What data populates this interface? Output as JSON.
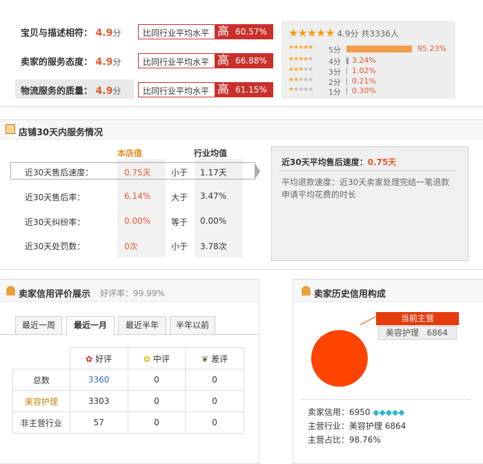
{
  "ratings": [
    {
      "label": "宝贝与描述相符：",
      "score": "4.9",
      "unit": "分",
      "compare": "比同行业平均水平",
      "level": "高",
      "pct": "60.57%"
    },
    {
      "label": "卖家的服务态度：",
      "score": "4.9",
      "unit": "分",
      "compare": "比同行业平均水平",
      "level": "高",
      "pct": "66.88%"
    },
    {
      "label": "物流服务的质量：",
      "score": "4.9",
      "unit": "分",
      "compare": "比同行业平均水平",
      "level": "高",
      "pct": "61.15%"
    }
  ],
  "summary": {
    "score": "4.9分",
    "total": "共3336人"
  },
  "distribution": [
    {
      "label": "5分",
      "pct": "95.23%",
      "stars": 5,
      "fraction": 0.9523
    },
    {
      "label": "4分",
      "pct": "3.24%",
      "stars": 4,
      "fraction": 0.0324
    },
    {
      "label": "3分",
      "pct": "1.02%",
      "stars": 3,
      "fraction": 0.0102
    },
    {
      "label": "2分",
      "pct": "0.21%",
      "stars": 2,
      "fraction": 0.0021
    },
    {
      "label": "1分",
      "pct": "0.30%",
      "stars": 1,
      "fraction": 0.003
    }
  ],
  "service": {
    "title": "店铺30天内服务情况",
    "col_store": "本店值",
    "col_avg": "行业均值",
    "rows": [
      {
        "label": "近30天售后速度：",
        "value": "0.75天",
        "cmp": "小于",
        "avg": "1.17天"
      },
      {
        "label": "近30天售后率：",
        "value": "6.14%",
        "cmp": "大于",
        "avg": "3.47%"
      },
      {
        "label": "近30天纠纷率：",
        "value": "0.00%",
        "cmp": "等于",
        "avg": "0.00%"
      },
      {
        "label": "近30天处罚数：",
        "value": "0次",
        "cmp": "小于",
        "avg": "3.78次"
      }
    ],
    "detail_title": "近30天平均售后速度：",
    "detail_value": "0.75天",
    "detail_desc": "平均退款速度：近30天卖家处理完结一笔退款申请平均花费的时长"
  },
  "credit": {
    "title": "卖家信用评价展示",
    "good_rate": "好评率：99.99%",
    "tabs": [
      "最近一周",
      "最近一月",
      "最近半年",
      "半年以前"
    ],
    "active_tab": "最近一月",
    "headers": [
      "好评",
      "中评",
      "差评"
    ],
    "rows": [
      {
        "label": "总数",
        "values": [
          "3360",
          "0",
          "0"
        ]
      },
      {
        "label": "美容护理",
        "values": [
          "3303",
          "0",
          "0"
        ]
      },
      {
        "label": "非主营行业",
        "values": [
          "57",
          "0",
          "0"
        ]
      }
    ]
  },
  "history": {
    "title": "卖家历史信用构成",
    "main_tag": "当前主营",
    "main_industry": "美容护理",
    "main_value": "6864",
    "credit_label": "卖家信用：",
    "credit_value": "6950",
    "industry_label": "主营行业：",
    "industry_value": "美容护理 6864",
    "ratio_label": "主营占比：",
    "ratio_value": "98.76%"
  },
  "colors": {
    "accent": "#e4572e",
    "high_red": "#c9302c",
    "orange_bar": "#f39c4a",
    "pie": "#ff4400"
  }
}
